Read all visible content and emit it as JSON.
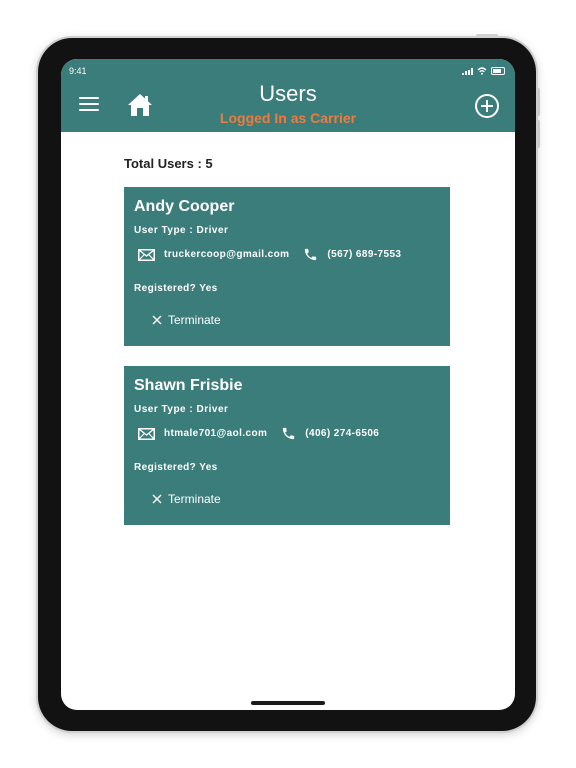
{
  "status_bar": {
    "time": "9:41"
  },
  "header": {
    "title": "Users",
    "subtitle": "Logged In as Carrier",
    "accent_color": "#3b7d7b",
    "subtitle_color": "#ee7b3d"
  },
  "icons": {
    "menu": "hamburger-menu-icon",
    "home": "home-icon",
    "add": "add-circle-icon",
    "email": "envelope-icon",
    "phone": "phone-icon",
    "terminate": "close-icon"
  },
  "summary": {
    "total_label": "Total Users : 5"
  },
  "users": [
    {
      "name": "Andy Cooper",
      "type": "User Type : Driver",
      "email": "truckercoop@gmail.com",
      "phone": "(567) 689-7553",
      "registered": "Registered? Yes",
      "action_label": "Terminate"
    },
    {
      "name": "Shawn Frisbie",
      "type": "User Type : Driver",
      "email": "htmale701@aol.com",
      "phone": "(406) 274-6506",
      "registered": "Registered? Yes",
      "action_label": "Terminate"
    }
  ]
}
